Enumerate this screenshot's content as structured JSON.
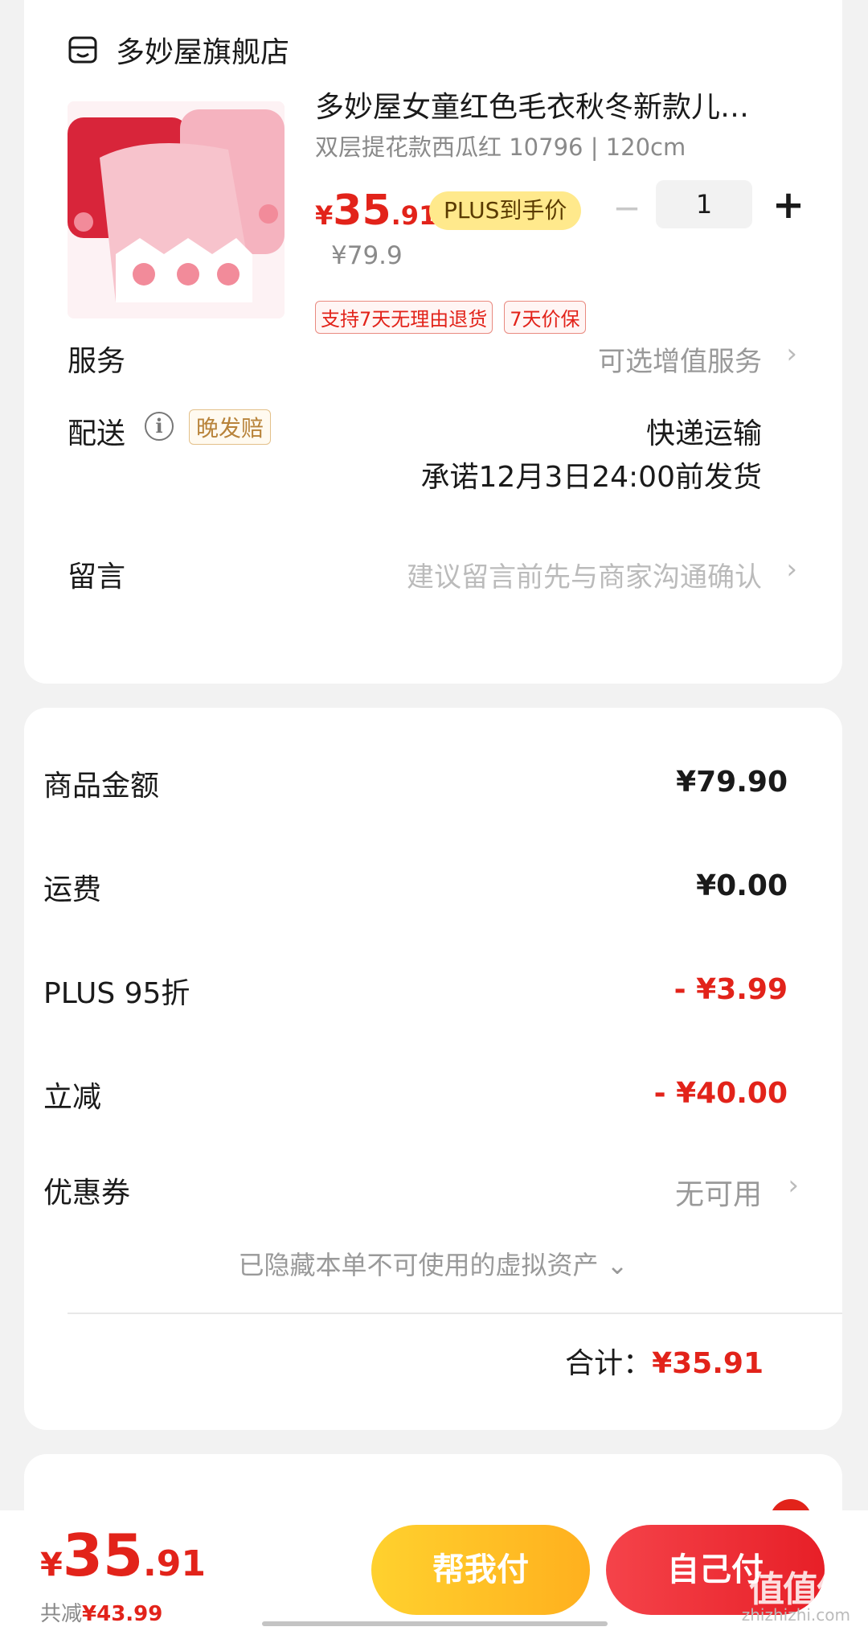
{
  "store": {
    "name": "多妙屋旗舰店",
    "icon": "store-icon"
  },
  "product": {
    "title": "多妙屋女童红色毛衣秋冬新款儿…",
    "spec": "双层提花款西瓜红 10796 | 120cm",
    "price_currency": "¥",
    "price_int": "35",
    "price_dec": ".91",
    "plus_tag": "PLUS到手价",
    "original_price": "¥79.9",
    "quantity": "1",
    "minus_symbol": "−",
    "plus_symbol": "+",
    "policies": [
      "支持7天无理由退货",
      "7天价保"
    ]
  },
  "service": {
    "label": "服务",
    "value": "可选增值服务"
  },
  "delivery": {
    "label": "配送",
    "late_tag": "晚发赔",
    "method": "快递运输",
    "promise": "承诺12月3日24:00前发货"
  },
  "message": {
    "label": "留言",
    "placeholder": "建议留言前先与商家沟通确认"
  },
  "fees": {
    "goods_label": "商品金额",
    "goods_value": "¥79.90",
    "shipping_label": "运费",
    "shipping_value": "¥0.00",
    "plus_label": "PLUS 95折",
    "plus_value": "- ¥3.99",
    "instant_label": "立减",
    "instant_value": "- ¥40.00",
    "coupon_label": "优惠券",
    "coupon_value": "无可用",
    "hidden_assets": "已隐藏本单不可使用的虚拟资产 ⌄",
    "total_label": "合计：",
    "total_value": "¥35.91"
  },
  "bottom": {
    "price_currency": "¥",
    "price_int": "35",
    "price_dec": ".91",
    "saved_label": "共减",
    "saved_value": "¥43.99",
    "help_pay": "帮我付",
    "self_pay": "自己付",
    "watermark": "值值值",
    "watermark_sub": "zhizhizhi.com"
  },
  "colors": {
    "accent_red": "#e2231a",
    "plus_gold": "#ffe98c",
    "help_yellow": "#ffb01e"
  }
}
